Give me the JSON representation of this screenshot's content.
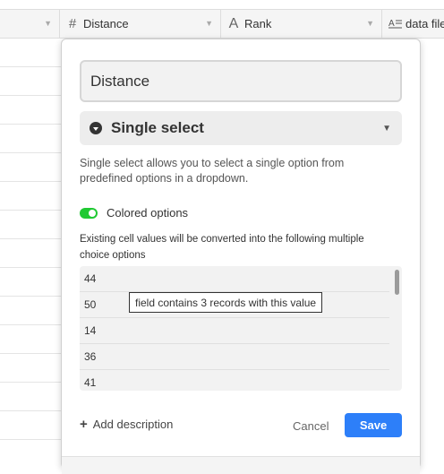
{
  "grid": {
    "columns": [
      {
        "name": "",
        "icon": ""
      },
      {
        "name": "Distance",
        "icon": "hash-icon"
      },
      {
        "name": "Rank",
        "icon": "text-a-icon"
      },
      {
        "name": "data file",
        "icon": "long-text-icon"
      }
    ]
  },
  "field_editor": {
    "field_name": "Distance",
    "field_type": "Single select",
    "type_description": "Single select allows you to select a single option from predefined options in a dropdown.",
    "colored_options_label": "Colored options",
    "colored_options_enabled": true,
    "conversion_note": "Existing cell values will be converted into the following multiple choice options",
    "options": [
      "44",
      "50",
      "14",
      "36",
      "41"
    ],
    "tooltip": "field contains 3 records with this value",
    "add_description_label": "Add description",
    "cancel_label": "Cancel",
    "save_label": "Save"
  },
  "colors": {
    "accent": "#2d7ff9",
    "toggle_on": "#20c933"
  }
}
